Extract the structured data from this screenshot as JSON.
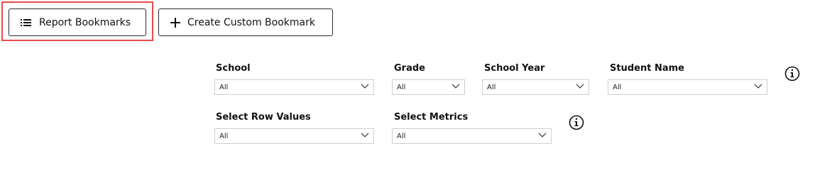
{
  "toolbar": {
    "report_bookmarks_label": "Report Bookmarks",
    "create_custom_bookmark_label": "Create Custom Bookmark"
  },
  "filters": {
    "school": {
      "label": "School",
      "value": "All"
    },
    "grade": {
      "label": "Grade",
      "value": "All"
    },
    "school_year": {
      "label": "School Year",
      "value": "All"
    },
    "student_name": {
      "label": "Student Name",
      "value": "All"
    },
    "row_values": {
      "label": "Select Row Values",
      "value": "All"
    },
    "metrics": {
      "label": "Select Metrics",
      "value": "All"
    }
  },
  "colors": {
    "highlight": "#e84b4b",
    "border": "#2b2b2b",
    "select_border": "#cfcfcf"
  },
  "icons": {
    "report_bookmarks": "list-icon",
    "create_custom_bookmark": "plus-icon",
    "dropdown": "chevron-down-icon",
    "info": "info-icon"
  }
}
